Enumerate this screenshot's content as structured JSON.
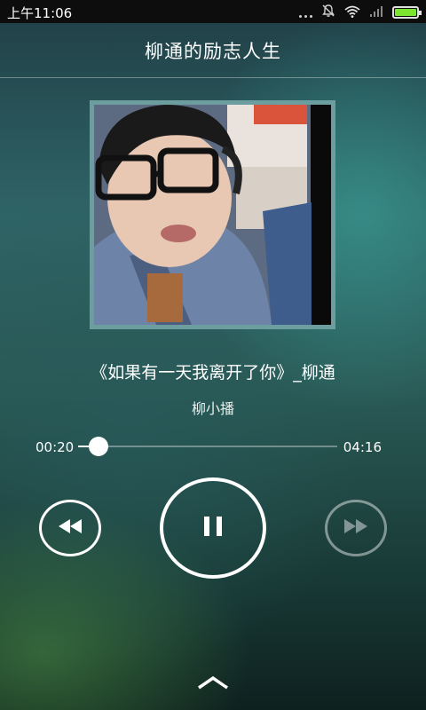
{
  "status_bar": {
    "time": "上午11:06",
    "icons": [
      "more-dots-icon",
      "notification-muted-icon",
      "wifi-icon",
      "signal-icon",
      "battery-icon"
    ],
    "battery_color": "#7be52f"
  },
  "header": {
    "title": "柳通的励志人生"
  },
  "player": {
    "song_title": "《如果有一天我离开了你》_柳通",
    "artist": "柳小播",
    "elapsed": "00:20",
    "duration": "04:16",
    "progress_fraction": 0.078,
    "controls": {
      "prev_icon": "rewind-icon",
      "play_pause_icon": "pause-icon",
      "next_icon": "fast-forward-icon"
    }
  },
  "footer": {
    "expand_icon": "chevron-up-icon"
  }
}
